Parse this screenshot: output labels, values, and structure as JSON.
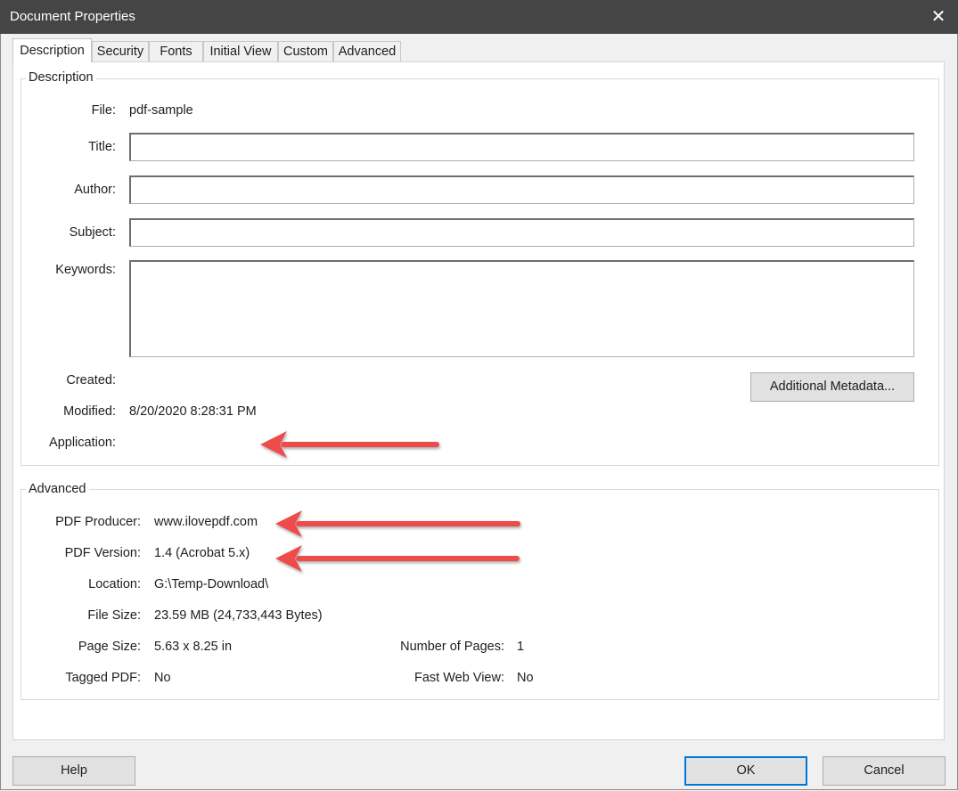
{
  "window": {
    "title": "Document Properties",
    "close_glyph": "✕"
  },
  "tabs": [
    {
      "label": "Description"
    },
    {
      "label": "Security"
    },
    {
      "label": "Fonts"
    },
    {
      "label": "Initial View"
    },
    {
      "label": "Custom"
    },
    {
      "label": "Advanced"
    }
  ],
  "active_tab": "Description",
  "description": {
    "group_title": "Description",
    "file_label": "File:",
    "file_value": "pdf-sample",
    "title_label": "Title:",
    "title_value": "",
    "author_label": "Author:",
    "author_value": "",
    "subject_label": "Subject:",
    "subject_value": "",
    "keywords_label": "Keywords:",
    "keywords_value": "",
    "created_label": "Created:",
    "created_value": "",
    "modified_label": "Modified:",
    "modified_value": "8/20/2020 8:28:31 PM",
    "application_label": "Application:",
    "application_value": "",
    "metadata_button": "Additional Metadata..."
  },
  "advanced": {
    "group_title": "Advanced",
    "producer_label": "PDF Producer:",
    "producer_value": "www.ilovepdf.com",
    "version_label": "PDF Version:",
    "version_value": "1.4 (Acrobat 5.x)",
    "location_label": "Location:",
    "location_value": "G:\\Temp-Download\\",
    "filesize_label": "File Size:",
    "filesize_value": "23.59 MB (24,733,443 Bytes)",
    "pagesize_label": "Page Size:",
    "pagesize_value": "5.63 x 8.25 in",
    "numpages_label": "Number of Pages:",
    "numpages_value": "1",
    "tagged_label": "Tagged PDF:",
    "tagged_value": "No",
    "fastweb_label": "Fast Web View:",
    "fastweb_value": "No"
  },
  "footer": {
    "help": "Help",
    "ok": "OK",
    "cancel": "Cancel"
  },
  "colors": {
    "titlebar": "#454545",
    "annotation_arrow": "#ee4b4b",
    "default_button_border": "#0078d7"
  }
}
